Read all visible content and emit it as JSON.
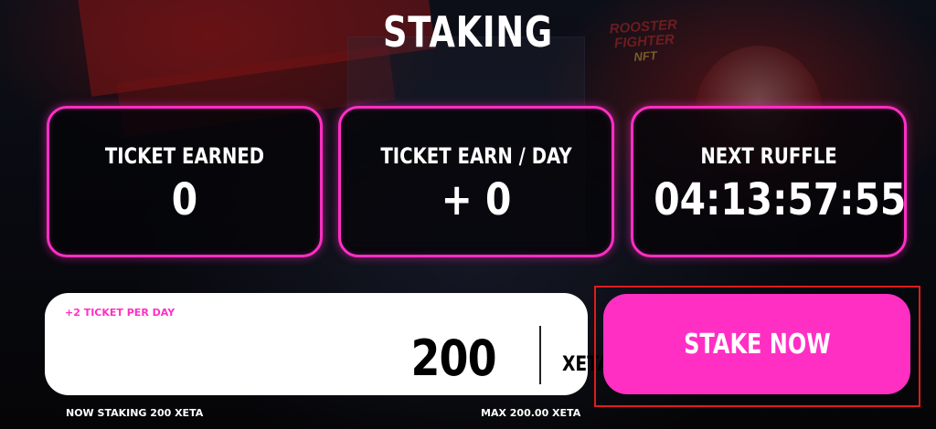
{
  "page": {
    "title": "STAKING"
  },
  "background": {
    "brand_line1": "ROOSTER",
    "brand_line2": "FIGHTER",
    "brand_line3": "NFT"
  },
  "stats": [
    {
      "label": "TICKET EARNED",
      "value": "0"
    },
    {
      "label": "TICKET EARN / DAY",
      "value": "+ 0"
    },
    {
      "label": "NEXT RUFFLE",
      "value": "04:13:57:55"
    }
  ],
  "stake_form": {
    "hint": "+2 TICKET PER DAY",
    "amount": "200",
    "unit": "XETA",
    "button_label": "STAKE NOW",
    "now_staking": "NOW STAKING 200 XETA",
    "max": "MAX 200.00 XETA"
  },
  "colors": {
    "accent": "#ff2fc4",
    "highlight_border": "#e01c1c",
    "background": "#07070b"
  }
}
